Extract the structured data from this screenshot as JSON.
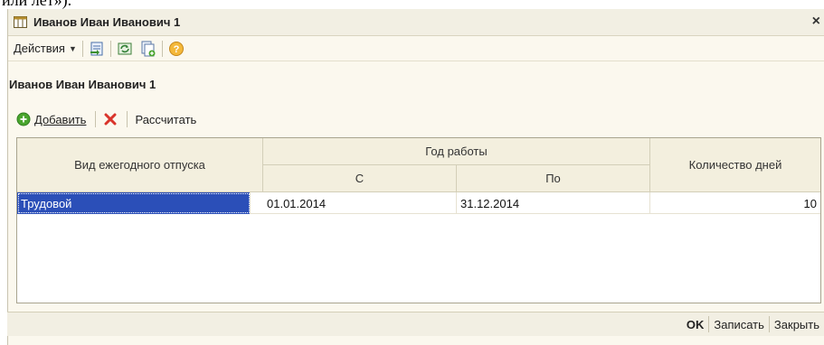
{
  "top_fragment": "или лет»).",
  "window": {
    "title": "Иванов Иван Иванович 1",
    "close_glyph": "×"
  },
  "toolbar": {
    "actions_label": "Действия",
    "icons": [
      "arrow-in-icon",
      "refresh-icon",
      "copy-add-icon",
      "help-icon"
    ]
  },
  "page_heading": "Иванов Иван Иванович 1",
  "grid_toolbar": {
    "add_label": "Добавить",
    "calculate_label": "Рассчитать"
  },
  "table": {
    "headers": {
      "leave_type": "Вид ежегодного отпуска",
      "work_year": "Год работы",
      "from": "С",
      "to": "По",
      "days": "Количество дней"
    },
    "rows": [
      {
        "leave_type": "Трудовой",
        "from": "01.01.2014",
        "to": "31.12.2014",
        "days": "10"
      }
    ]
  },
  "bottom": {
    "ok": "OK",
    "save": "Записать",
    "close": "Закрыть"
  },
  "colors": {
    "selection": "#2b4fb8",
    "add_green": "#4aa52e",
    "delete_red": "#d9342b"
  }
}
